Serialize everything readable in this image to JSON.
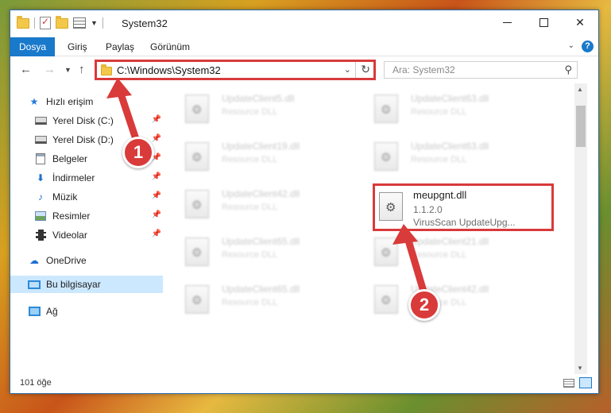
{
  "window": {
    "title": "System32"
  },
  "ribbon": {
    "tabs": [
      "Dosya",
      "Giriş",
      "Paylaş",
      "Görünüm"
    ]
  },
  "nav": {
    "address": "C:\\Windows\\System32",
    "search_placeholder": "Ara: System32"
  },
  "sidebar": {
    "items": [
      {
        "label": "Hızlı erişim",
        "icon": "star-icon"
      },
      {
        "label": "Yerel Disk (C:)",
        "icon": "drive-icon"
      },
      {
        "label": "Yerel Disk (D:)",
        "icon": "drive-icon"
      },
      {
        "label": "Belgeler",
        "icon": "documents-icon"
      },
      {
        "label": "İndirmeler",
        "icon": "download-icon"
      },
      {
        "label": "Müzik",
        "icon": "music-icon"
      },
      {
        "label": "Resimler",
        "icon": "pictures-icon"
      },
      {
        "label": "Videolar",
        "icon": "video-icon"
      },
      {
        "label": "OneDrive",
        "icon": "cloud-icon"
      },
      {
        "label": "Bu bilgisayar",
        "icon": "computer-icon"
      },
      {
        "label": "Ağ",
        "icon": "network-icon"
      }
    ]
  },
  "files": [
    {
      "name": "UpdateClient5.dll",
      "desc": "Resource DLL"
    },
    {
      "name": "UpdateClient63.dll",
      "desc": "Resource DLL"
    },
    {
      "name": "UpdateClient19.dll",
      "desc": "Resource DLL"
    },
    {
      "name": "UpdateClient63.dll",
      "desc": "Resource DLL"
    },
    {
      "name": "UpdateClient42.dll",
      "desc": "Resource DLL"
    },
    {
      "name": "meupgnt.dll",
      "version": "1.1.2.0",
      "desc": "VirusScan UpdateUpg..."
    },
    {
      "name": "UpdateClient65.dll",
      "desc": "Resource DLL"
    },
    {
      "name": "UpdateClient21.dll",
      "desc": "Resource DLL"
    },
    {
      "name": "UpdateClient65.dll",
      "desc": "Resource DLL"
    },
    {
      "name": "UpdateClient42.dll",
      "desc": "Resource DLL"
    }
  ],
  "status": {
    "count": "101 öğe"
  },
  "annotations": {
    "badge1": "1",
    "badge2": "2",
    "color": "#d93a3a"
  }
}
